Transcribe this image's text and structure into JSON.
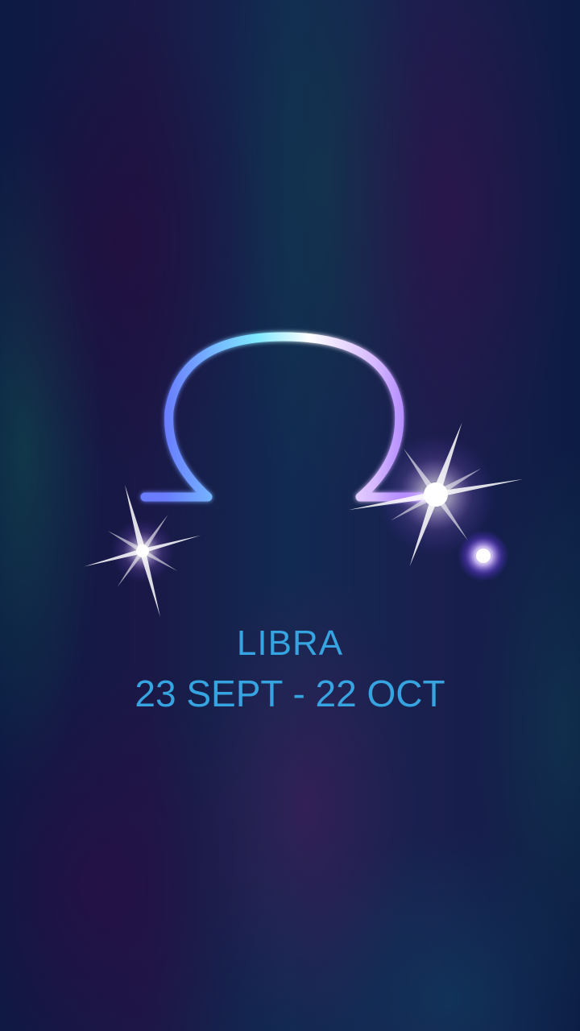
{
  "sign": {
    "name": "LIBRA",
    "dates": "23 SEPT - 22 OCT"
  },
  "colors": {
    "text": "#36a4e0",
    "glow_cyan": "#7fe9ff",
    "glow_violet": "#9a6bff",
    "background": "#10183a"
  },
  "icons": {
    "symbol": "libra-zodiac-icon",
    "sparkles": [
      "star-sparkle",
      "star-sparkle",
      "glow-dot"
    ]
  }
}
